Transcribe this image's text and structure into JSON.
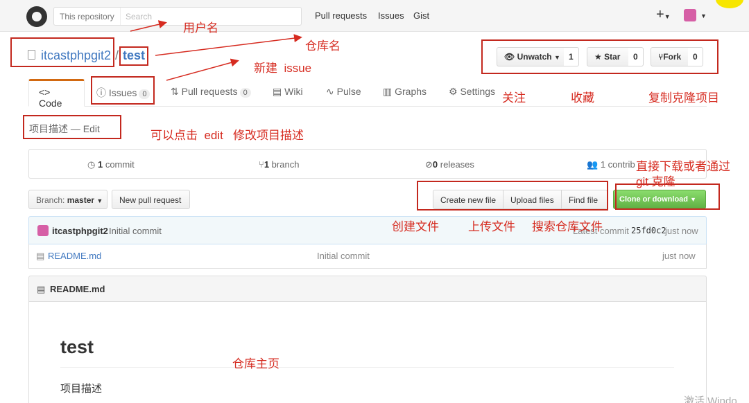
{
  "header": {
    "search_scope": "This repository",
    "search_placeholder": "Search",
    "nav": [
      "Pull requests",
      "Issues",
      "Gist"
    ],
    "plus": "+"
  },
  "repo": {
    "owner": "itcastphpgit2",
    "separator": "/",
    "name": "test",
    "watch_label": "Unwatch",
    "watch_count": "1",
    "star_label": "Star",
    "star_count": "0",
    "fork_label": "Fork",
    "fork_count": "0"
  },
  "tabs": {
    "code": "Code",
    "issues": "Issues",
    "issues_count": "0",
    "pull_requests": "Pull requests",
    "pull_requests_count": "0",
    "wiki": "Wiki",
    "pulse": "Pulse",
    "graphs": "Graphs",
    "settings": "Settings"
  },
  "description": "项目描述 — Edit",
  "summary": {
    "commits": "1",
    "commits_label": "commit",
    "branches": "1",
    "branches_label": "branch",
    "releases": "0",
    "releases_label": "releases",
    "contributors_label": "1 contrib"
  },
  "file_nav": {
    "branch_prefix": "Branch:",
    "branch": "master",
    "new_pr": "New pull request",
    "create_file": "Create new file",
    "upload_files": "Upload files",
    "find_file": "Find file",
    "clone": "Clone or download"
  },
  "commit": {
    "author": "itcastphpgit2",
    "message": "Initial commit",
    "latest_label": "Latest commit",
    "sha": "25fd0c2",
    "time": "just now"
  },
  "files": [
    {
      "name": "README.md",
      "message": "Initial commit",
      "age": "just now"
    }
  ],
  "readme": {
    "header": "README.md",
    "title": "test",
    "text": "项目描述"
  },
  "annotations": {
    "username": "用户名",
    "repo_name": "仓库名",
    "new_issue_cn": "新建",
    "new_issue_en": "issue",
    "watch": "关注",
    "star": "收藏",
    "fork": "复制克隆项目",
    "edit_tip_1": "可以点击",
    "edit_tip_2": "edit",
    "edit_tip_3": "修改项目描述",
    "clone_tip_1": "直接下载或者通过",
    "clone_tip_2": "git  克隆",
    "create_file": "创建文件",
    "upload_file": "上传文件",
    "search_file": "搜索仓库文件",
    "home": "仓库主页"
  },
  "watermark": "激活 Windo",
  "colors": {
    "annotation": "#d62b20",
    "link": "#4078c0",
    "clone_green": "#60b044",
    "tab_accent": "#d26911"
  }
}
